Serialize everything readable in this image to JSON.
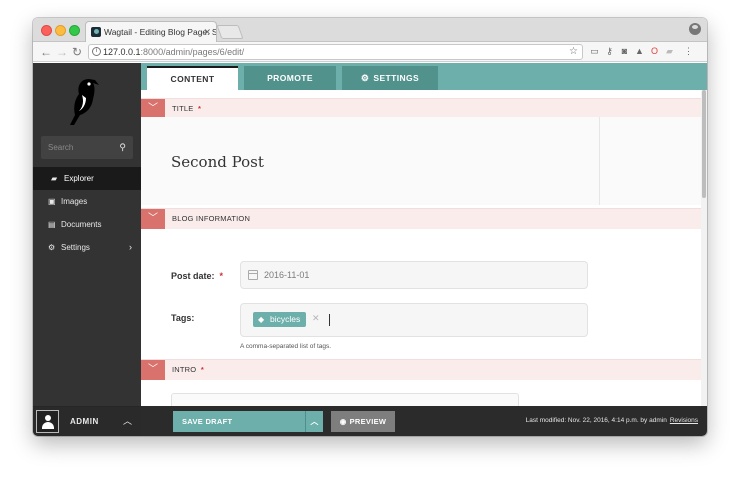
{
  "browser": {
    "tab_title": "Wagtail - Editing Blog Page: Se",
    "tab_close": "✕",
    "url_host": "127.0.0.1",
    "url_path": ":8000/admin/pages/6/edit/"
  },
  "sidebar": {
    "search_placeholder": "Search",
    "items": [
      {
        "label": "Explorer",
        "icon": "folder-open-icon",
        "glyph": "▰",
        "active": true
      },
      {
        "label": "Images",
        "icon": "image-icon",
        "glyph": "▣",
        "active": false
      },
      {
        "label": "Documents",
        "icon": "document-icon",
        "glyph": "▤",
        "active": false
      },
      {
        "label": "Settings",
        "icon": "cogs-icon",
        "glyph": "⚙",
        "active": false
      }
    ],
    "account_name": "ADMIN"
  },
  "tabs": {
    "content": "CONTENT",
    "promote": "PROMOTE",
    "settings": "SETTINGS"
  },
  "sections": {
    "title": "TITLE",
    "blog_info": "BLOG INFORMATION",
    "intro": "INTRO"
  },
  "required_mark": "*",
  "fields": {
    "title_value": "Second Post",
    "post_date_label": "Post date:",
    "post_date_value": "2016-11-01",
    "tags_label": "Tags:",
    "tag_value": "bicycles",
    "tag_remove": "✕",
    "tags_help": "A comma-separated list of tags."
  },
  "footer": {
    "save_draft": "SAVE DRAFT",
    "preview": "PREVIEW",
    "last_modified": "Last modified: Nov. 22, 2016, 4:14 p.m. by admin",
    "revisions": "Revisions"
  },
  "colors": {
    "teal": "#6cafab",
    "sidebar": "#333333",
    "section_toggle": "#d9726c",
    "section_bg": "#fbecec"
  }
}
